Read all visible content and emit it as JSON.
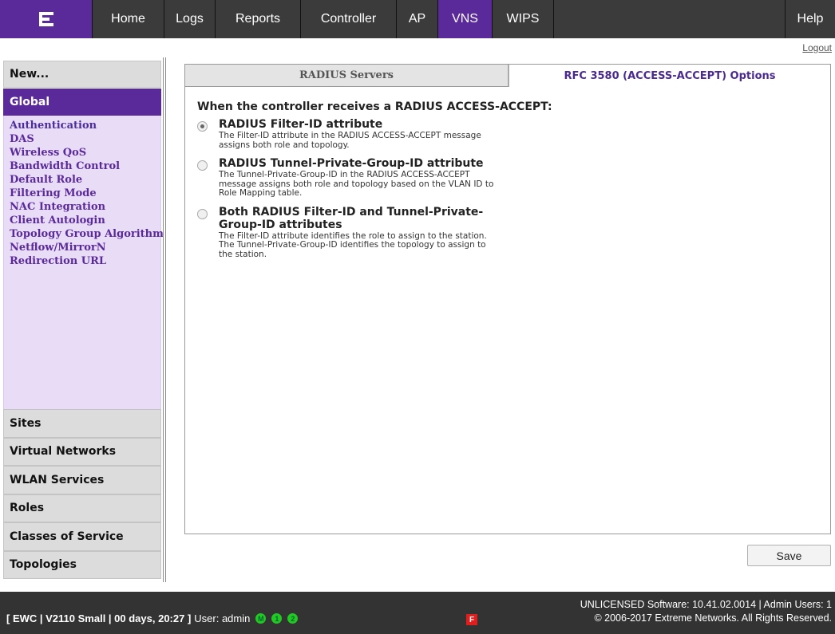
{
  "nav": {
    "logo_icon": "extreme-logo-icon",
    "items": [
      "Home",
      "Logs",
      "Reports",
      "Controller",
      "AP",
      "VNS",
      "WIPS"
    ],
    "active": "VNS",
    "help": "Help",
    "accent_color": "#5b2a9a"
  },
  "logout": "Logout",
  "sidebar": {
    "new": "New...",
    "global": "Global",
    "global_links": [
      "Authentication",
      "DAS",
      "Wireless QoS",
      "Bandwidth Control",
      "Default Role",
      "Filtering Mode",
      "NAC Integration",
      "Client Autologin",
      "Topology Group Algorithm",
      "Netflow/MirrorN",
      "Redirection URL"
    ],
    "sections": [
      "Sites",
      "Virtual Networks",
      "WLAN Services",
      "Roles",
      "Classes of Service",
      "Topologies"
    ]
  },
  "tabs": {
    "radius_servers": "RADIUS Servers",
    "rfc3580": "RFC 3580 (ACCESS-ACCEPT) Options"
  },
  "content": {
    "question": "When the controller receives a RADIUS ACCESS-ACCEPT:",
    "options": [
      {
        "title": "RADIUS Filter-ID attribute",
        "desc": "The Filter-ID attribute in the RADIUS ACCESS-ACCEPT message assigns both role and topology.",
        "checked": true
      },
      {
        "title": "RADIUS Tunnel-Private-Group-ID attribute",
        "desc": "The Tunnel-Private-Group-ID in the RADIUS ACCESS-ACCEPT message assigns both role and topology based on the VLAN ID to Role Mapping table.",
        "checked": false
      },
      {
        "title": "Both RADIUS Filter-ID and Tunnel-Private-Group-ID attributes",
        "desc": "The Filter-ID attribute identifies the role to assign to the station. The Tunnel-Private-Group-ID identifies the topology to assign to the station.",
        "checked": false
      }
    ]
  },
  "save": "Save",
  "footer": {
    "status": "[ EWC | V2110 Small | 00 days, 20:27 ]",
    "user": "User: admin",
    "indicators": [
      "M",
      "1",
      "2"
    ],
    "flag": "F",
    "license": "UNLICENSED Software: 10.41.02.0014 | Admin Users: 1",
    "copyright": "© 2006-2017  Extreme Networks. All Rights Reserved."
  }
}
